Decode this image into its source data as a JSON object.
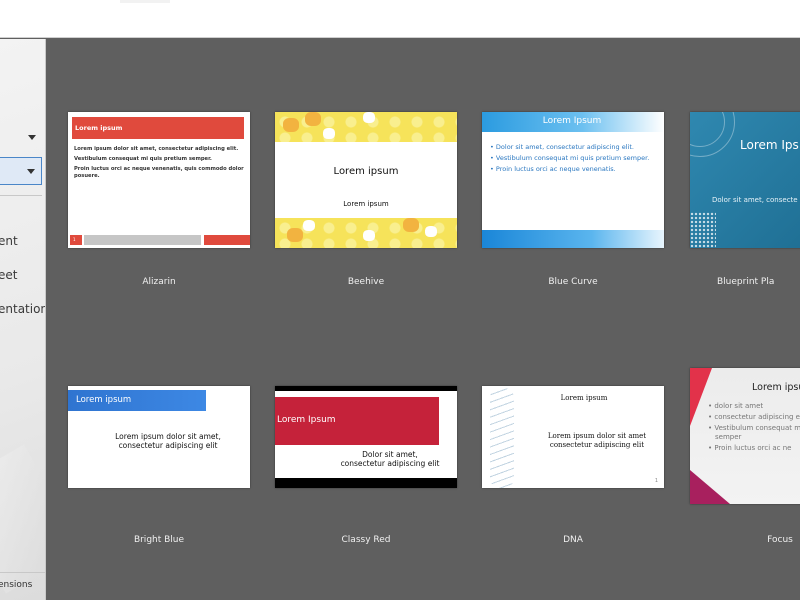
{
  "sidebar": {
    "items": [
      {
        "label": "ent"
      },
      {
        "label": "eet"
      },
      {
        "label": "entation"
      }
    ],
    "extensions_label": "ensions"
  },
  "templates": [
    {
      "name": "Alizarin",
      "title": "Lorem ipsum",
      "lines": [
        "Lorem ipsum dolor sit amet, consectetur adipiscing elit.",
        "Vestibulum consequat mi quis pretium semper.",
        "Proin luctus orci ac neque venenatis, quis commodo dolor posuere."
      ],
      "page": "1",
      "accent": "#e04a3d"
    },
    {
      "name": "Beehive",
      "title": "Lorem ipsum",
      "subtitle": "Lorem ipsum",
      "accent": "#f6e35a"
    },
    {
      "name": "Blue Curve",
      "title": "Lorem Ipsum",
      "bullets": [
        "Dolor sit amet, consectetur adipiscing elit.",
        "Vestibulum consequat mi quis pretium semper.",
        "Proin luctus orci ac neque venenatis."
      ],
      "accent": "#2b9be0"
    },
    {
      "name": "Blueprint Pla",
      "title": "Lorem Ips",
      "subtitle": "Dolor sit amet, consecte",
      "accent": "#2f88b0"
    },
    {
      "name": "Bright Blue",
      "title": "Lorem ipsum",
      "body_1": "Lorem ipsum dolor sit amet,",
      "body_2": "consectetur adipiscing elit",
      "accent": "#2f74d0"
    },
    {
      "name": "Classy Red",
      "title": "Lorem Ipsum",
      "body_1": "Dolor sit amet,",
      "body_2": "consectetur adipiscing elit",
      "accent": "#c5223a"
    },
    {
      "name": "DNA",
      "title": "Lorem ipsum",
      "body_1": "Lorem ipsum dolor sit amet",
      "body_2": "consectetur adipiscing elit",
      "page": "1"
    },
    {
      "name": "Focus",
      "title": "Lorem ipsu",
      "bullets": [
        "dolor sit amet",
        "consectetur adipiscing e",
        "Vestibulum consequat m",
        "semper",
        "Proin luctus orci ac ne"
      ],
      "accent": "#e2324a"
    }
  ]
}
